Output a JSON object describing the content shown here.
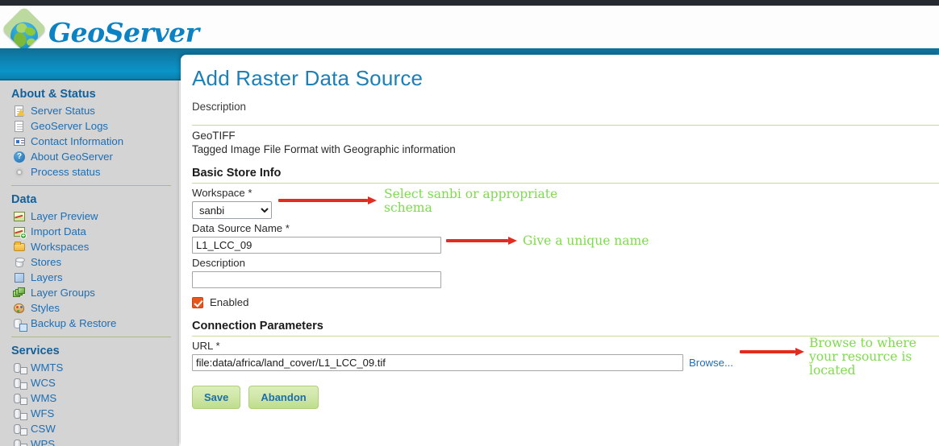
{
  "brand": {
    "name": "GeoServer",
    "logo_icon": "geoserver-globe-logo"
  },
  "sidebar": {
    "sections": [
      {
        "heading": "About & Status",
        "items": [
          {
            "label": "Server Status",
            "icon": "server-status-icon"
          },
          {
            "label": "GeoServer Logs",
            "icon": "logs-document-icon"
          },
          {
            "label": "Contact Information",
            "icon": "contact-card-icon"
          },
          {
            "label": "About GeoServer",
            "icon": "info-circle-icon"
          },
          {
            "label": "Process status",
            "icon": "gear-icon"
          }
        ]
      },
      {
        "heading": "Data",
        "items": [
          {
            "label": "Layer Preview",
            "icon": "map-preview-icon"
          },
          {
            "label": "Import Data",
            "icon": "map-import-icon"
          },
          {
            "label": "Workspaces",
            "icon": "folder-icon"
          },
          {
            "label": "Stores",
            "icon": "database-cylinder-icon"
          },
          {
            "label": "Layers",
            "icon": "layer-square-icon"
          },
          {
            "label": "Layer Groups",
            "icon": "layer-stack-icon"
          },
          {
            "label": "Styles",
            "icon": "palette-icon"
          },
          {
            "label": "Backup & Restore",
            "icon": "backup-restore-icon"
          }
        ]
      },
      {
        "heading": "Services",
        "items": [
          {
            "label": "WMTS",
            "icon": "service-wmts-icon"
          },
          {
            "label": "WCS",
            "icon": "service-wcs-icon"
          },
          {
            "label": "WMS",
            "icon": "service-wms-icon"
          },
          {
            "label": "WFS",
            "icon": "service-wfs-icon"
          },
          {
            "label": "CSW",
            "icon": "service-csw-icon"
          },
          {
            "label": "WPS",
            "icon": "service-wps-icon"
          }
        ]
      }
    ]
  },
  "main": {
    "title": "Add Raster Data Source",
    "description_label": "Description",
    "format_name": "GeoTIFF",
    "format_description": "Tagged Image File Format with Geographic information",
    "basic_store_info": {
      "section_title": "Basic Store Info",
      "workspace_label": "Workspace *",
      "workspace_value": "sanbi",
      "workspace_options": [
        "sanbi"
      ],
      "data_source_name_label": "Data Source Name *",
      "data_source_name_value": "L1_LCC_09",
      "description_field_label": "Description",
      "description_field_value": "",
      "enabled_label": "Enabled",
      "enabled_checked": true
    },
    "connection_parameters": {
      "section_title": "Connection Parameters",
      "url_label": "URL *",
      "url_value": "file:data/africa/land_cover/L1_LCC_09.tif",
      "browse_label": "Browse..."
    },
    "buttons": {
      "save_label": "Save",
      "abandon_label": "Abandon"
    }
  },
  "annotations": [
    {
      "text": "Select sanbi or appropriate\nschema"
    },
    {
      "text": "Give a unique name"
    },
    {
      "text": "Browse to where\nyour resource is\nlocated"
    }
  ],
  "colors": {
    "brand_blue": "#0a82c4",
    "banner_blue": "#0d87b8",
    "link_blue": "#1c6eb5",
    "title_blue": "#1b7fb8",
    "divider_green": "#c5dc9c",
    "button_green": "#cfe7a7",
    "checkbox_orange": "#e8561e",
    "annotation_green": "#7ddc4a",
    "arrow_red": "#e32b1e",
    "sidebar_gray": "#d4d4d4",
    "topbar_dark": "#252a30"
  }
}
